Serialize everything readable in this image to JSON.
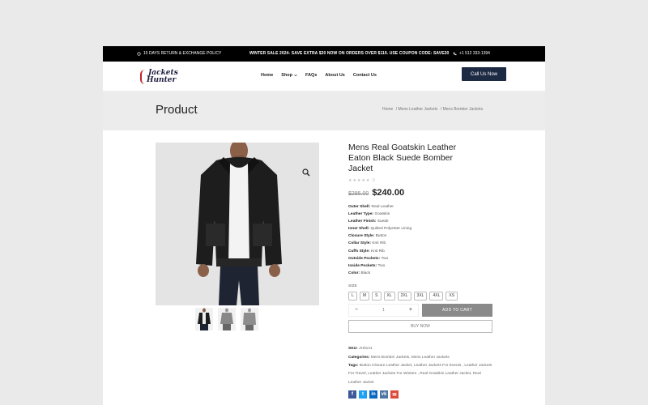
{
  "topbar": {
    "return_policy": "15 DAYS RETURN & EXCHANGE POLICY",
    "promo": "WINTER SALE 2024- SAVE EXTRA $20 NOW ON ORDERS OVER $119. USE COUPON CODE: SAVE20",
    "phone": "+1 512 333-1394"
  },
  "header": {
    "logo_line1": "Jackets",
    "logo_line2": "Hunter",
    "nav": [
      "Home",
      "Shop",
      "FAQs",
      "About Us",
      "Contact Us"
    ],
    "call_button": "Call Us Now"
  },
  "banner": {
    "title": "Product",
    "breadcrumbs": [
      "Home",
      "/ Mens Leather Jackets",
      "/ Mens Bomber Jackets"
    ]
  },
  "product": {
    "title": "Mens Real Goatskin Leather Eaton Black Suede Bomber Jacket",
    "rating_count": "0",
    "old_price": "$295.00",
    "price": "$240.00",
    "specs": [
      {
        "label": "Outer Shell:",
        "value": "Real Leather"
      },
      {
        "label": "Leather Type:",
        "value": "Goatskin"
      },
      {
        "label": "Leather Finish:",
        "value": "Suede"
      },
      {
        "label": "Inner Shell:",
        "value": "Quilted Polyester Lining"
      },
      {
        "label": "Closure Style:",
        "value": "Button"
      },
      {
        "label": "Collar Style:",
        "value": "Knit Rib"
      },
      {
        "label": "Cuffs Style:",
        "value": "Knit Rib"
      },
      {
        "label": "Outside Pockets:",
        "value": "Two"
      },
      {
        "label": "Inside Pockets:",
        "value": "Two"
      },
      {
        "label": "Color:",
        "value": "Black"
      }
    ],
    "size_label": "SIZE",
    "sizes": [
      "L",
      "M",
      "S",
      "XL",
      "2XL",
      "3XL",
      "4XL",
      "XS"
    ],
    "quantity": "1",
    "qty_minus": "−",
    "qty_plus": "+",
    "add_to_cart": "ADD TO CART",
    "buy_now": "BUY NOW",
    "sku_label": "SKU:",
    "sku": "JH0141",
    "categories_label": "Categories:",
    "categories": "Mens Bomber Jackets, Mens Leather Jackets",
    "tags_label": "Tags:",
    "tags": "Button Closure Leather Jacket, Leather Jackets For Events , Leather Jackets For Travel, Leather Jackets For Winters , Real Goatskin Leather Jacket, Real Leather Jacket"
  },
  "share_icons": [
    "facebook-icon",
    "twitter-icon",
    "linkedin-icon",
    "vk-icon",
    "email-icon"
  ],
  "colors": {
    "topbar": "#000000",
    "call_button": "#1d2a44",
    "add_to_cart": "#8a8a8a",
    "banner": "#ececec"
  }
}
